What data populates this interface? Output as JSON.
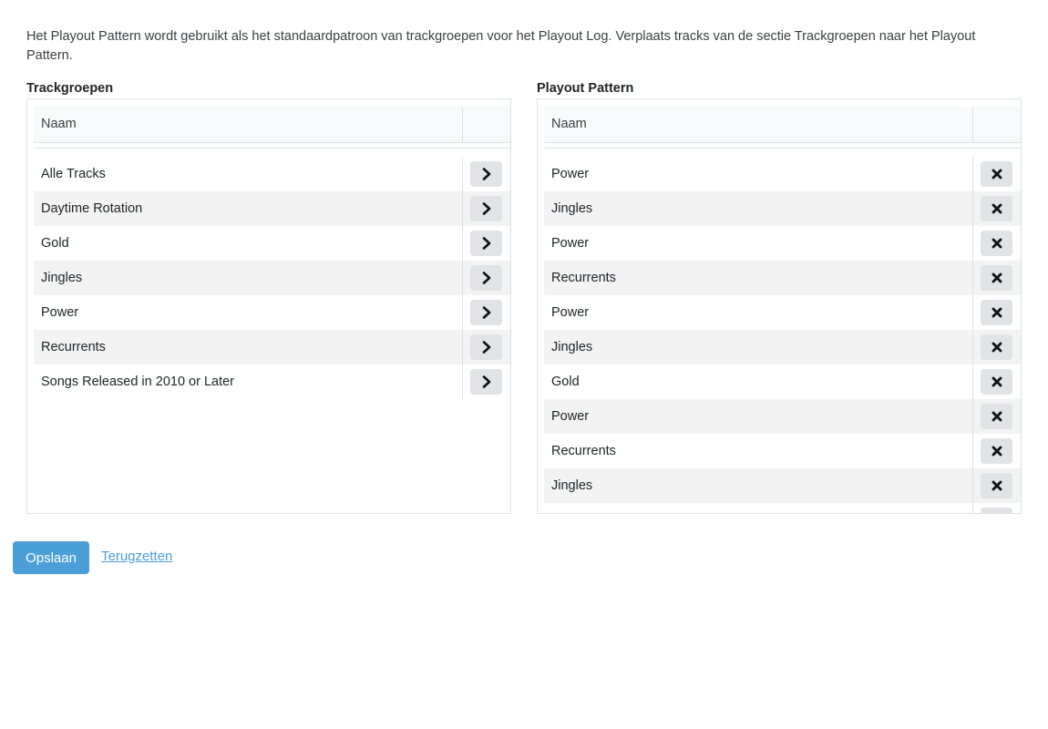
{
  "intro_text": "Het Playout Pattern wordt gebruikt als het standaardpatroon van trackgroepen voor het Playout Log. Verplaats tracks van de sectie Trackgroepen naar het Playout Pattern.",
  "left_panel": {
    "title": "Trackgroepen",
    "column_header": "Naam",
    "row_action_icon": "chevron-right-icon",
    "rows": [
      "Alle Tracks",
      "Daytime Rotation",
      "Gold",
      "Jingles",
      "Power",
      "Recurrents",
      "Songs Released in 2010 or Later"
    ]
  },
  "right_panel": {
    "title": "Playout Pattern",
    "column_header": "Naam",
    "row_action_icon": "close-icon",
    "rows": [
      "Power",
      "Jingles",
      "Power",
      "Recurrents",
      "Power",
      "Jingles",
      "Gold",
      "Power",
      "Recurrents",
      "Jingles",
      ""
    ]
  },
  "actions": {
    "save_label": "Opslaan",
    "reset_label": "Terugzetten"
  },
  "colors": {
    "primary": "#4a9fd8",
    "row_button_bg": "#e1e3e6",
    "striped_row_bg": "#f3f3f4",
    "border": "#dee2e6"
  }
}
